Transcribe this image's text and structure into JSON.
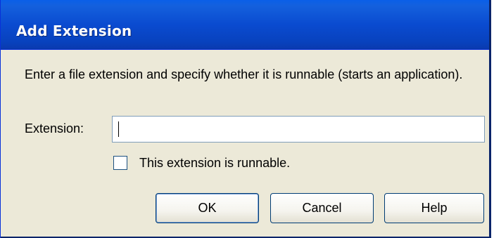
{
  "dialog": {
    "title": "Add Extension",
    "instructions": "Enter a file extension and specify whether it is runnable (starts an application).",
    "extension_label": "Extension:",
    "extension_value": "",
    "runnable_label": "This extension is runnable.",
    "runnable_checked": false
  },
  "buttons": {
    "ok_label": "OK",
    "cancel_label": "Cancel",
    "help_label": "Help"
  },
  "colors": {
    "titlebar": "#0A4BD0",
    "dialog_background": "#ECE9D8",
    "button_border": "#003C74"
  }
}
